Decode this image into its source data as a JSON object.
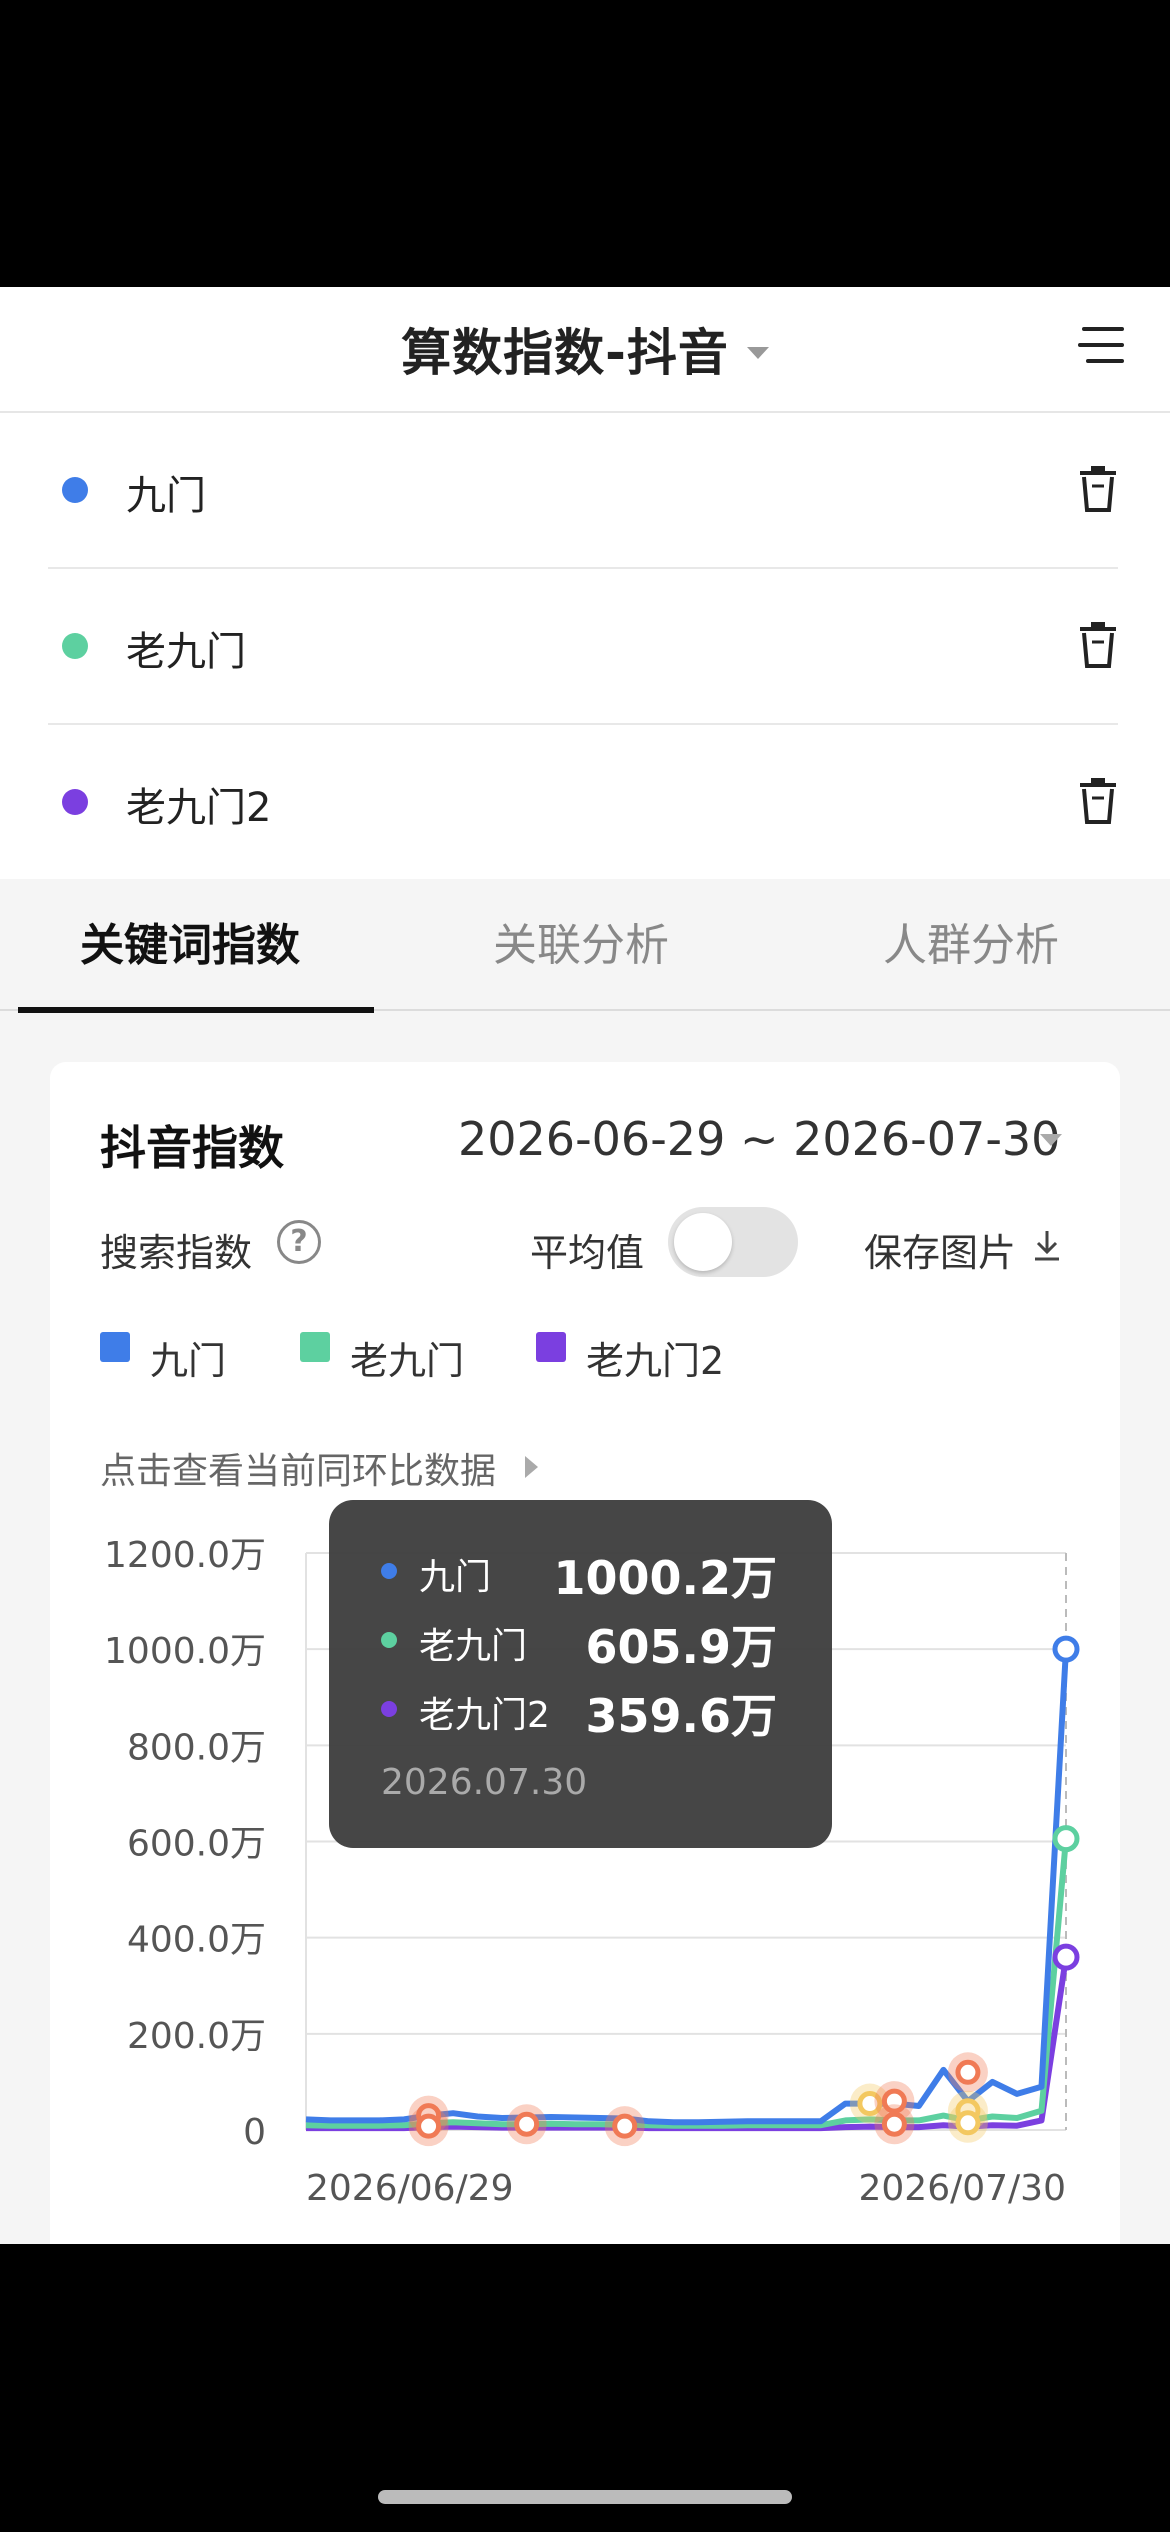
{
  "header": {
    "title": "算数指数-抖音"
  },
  "keywords": [
    {
      "label": "九门",
      "color": "#3f7de8"
    },
    {
      "label": "老九门",
      "color": "#5dd0a0"
    },
    {
      "label": "老九门2",
      "color": "#7b3fe0"
    }
  ],
  "tabs": [
    {
      "label": "关键词指数",
      "active": true
    },
    {
      "label": "关联分析",
      "active": false
    },
    {
      "label": "人群分析",
      "active": false
    }
  ],
  "card": {
    "title": "抖音指数",
    "date_range": "2026-06-29 ~ 2026-07-30",
    "search_index_label": "搜索指数",
    "help_glyph": "?",
    "average_label": "平均值",
    "save_label": "保存图片",
    "compare_label": "点击查看当前同环比数据"
  },
  "tooltip": {
    "rows": [
      {
        "name": "九门",
        "value": "1000.2万",
        "color": "#3f7de8"
      },
      {
        "name": "老九门",
        "value": "605.9万",
        "color": "#5dd0a0"
      },
      {
        "name": "老九门2",
        "value": "359.6万",
        "color": "#7b3fe0"
      }
    ],
    "date": "2026.07.30"
  },
  "chart_data": {
    "type": "line",
    "y_ticks": [
      "1200.0万",
      "1000.0万",
      "800.0万",
      "600.0万",
      "400.0万",
      "200.0万",
      "0"
    ],
    "ylim": [
      0,
      1200
    ],
    "x_tick_labels": [
      "2026/06/29",
      "2026/07/30"
    ],
    "x": [
      "06/29",
      "06/30",
      "07/01",
      "07/02",
      "07/03",
      "07/04",
      "07/05",
      "07/06",
      "07/07",
      "07/08",
      "07/09",
      "07/10",
      "07/11",
      "07/12",
      "07/13",
      "07/14",
      "07/15",
      "07/16",
      "07/17",
      "07/18",
      "07/19",
      "07/20",
      "07/21",
      "07/22",
      "07/23",
      "07/24",
      "07/25",
      "07/26",
      "07/27",
      "07/28",
      "07/29",
      "07/30"
    ],
    "series": [
      {
        "name": "九门",
        "color": "#3f7de8",
        "values": [
          22,
          20,
          20,
          20,
          22,
          30,
          35,
          28,
          25,
          26,
          27,
          26,
          25,
          24,
          18,
          16,
          16,
          17,
          18,
          18,
          18,
          18,
          55,
          55,
          55,
          50,
          125,
          60,
          100,
          75,
          90,
          1000.2
        ]
      },
      {
        "name": "老九门",
        "color": "#5dd0a0",
        "values": [
          10,
          9,
          9,
          9,
          10,
          14,
          16,
          14,
          12,
          12,
          13,
          12,
          12,
          11,
          10,
          9,
          9,
          9,
          10,
          10,
          10,
          10,
          20,
          22,
          20,
          20,
          30,
          20,
          28,
          25,
          40,
          605.9
        ]
      },
      {
        "name": "老九门2",
        "color": "#7b3fe0",
        "values": [
          4,
          4,
          4,
          4,
          4,
          6,
          7,
          6,
          5,
          5,
          5,
          5,
          5,
          5,
          4,
          4,
          4,
          4,
          4,
          4,
          4,
          4,
          6,
          7,
          6,
          6,
          10,
          7,
          10,
          9,
          20,
          359.6
        ]
      }
    ],
    "grid": true
  }
}
